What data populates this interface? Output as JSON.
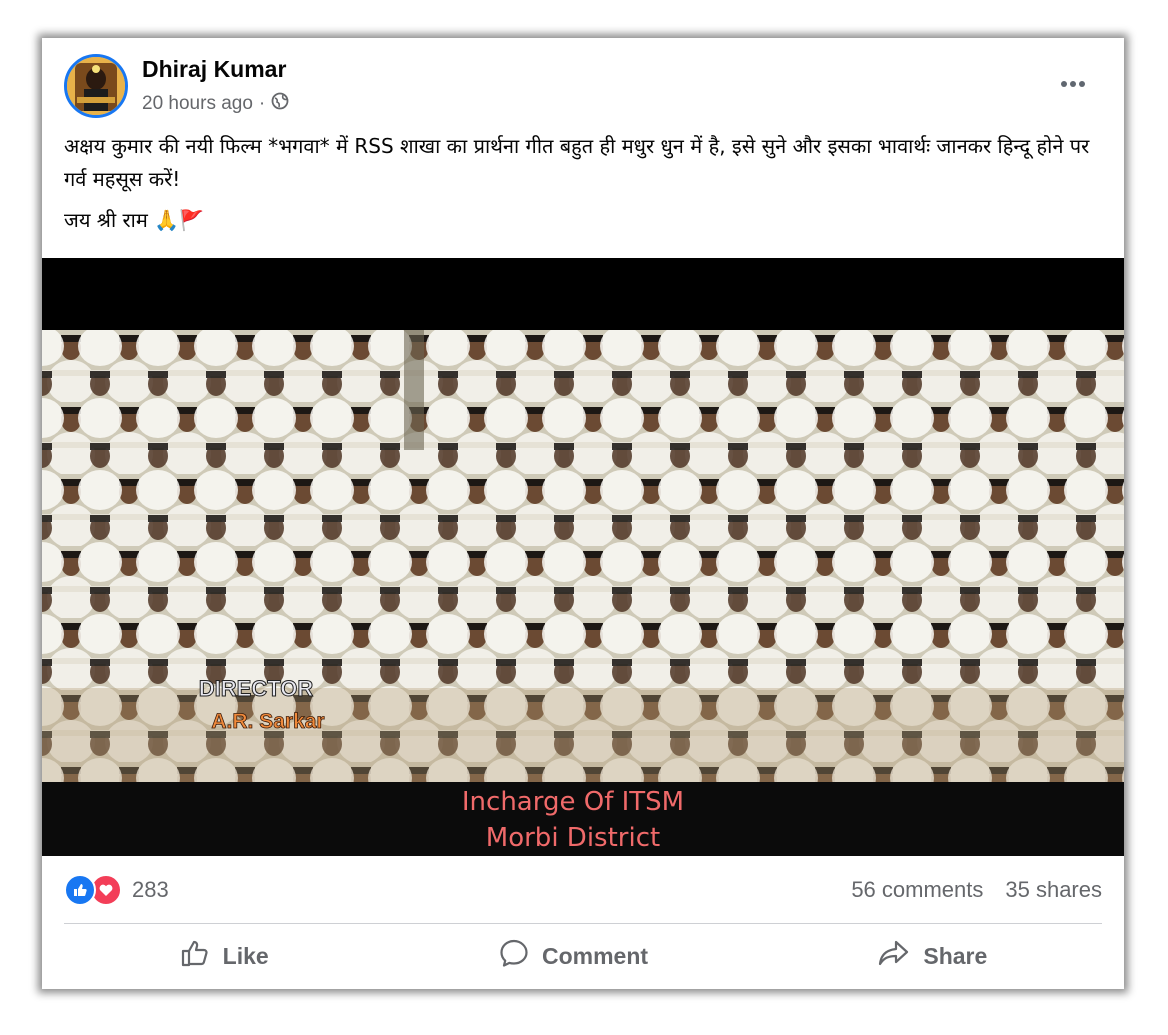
{
  "post": {
    "author": "Dhiraj Kumar",
    "time": "20 hours ago",
    "separator": "·",
    "privacy_icon": "globe-icon",
    "text_line1": "अक्षय कुमार की नयी फिल्म *भगवा* में RSS शाखा का प्रार्थना गीत बहुत ही मधुर धुन में है, इसे सुने और इसका भावार्थः जानकर हिन्दू होने पर गर्व महसूस करें!",
    "text_line2": "जय श्री राम 🙏🚩"
  },
  "video": {
    "credit_role": "DIRECTOR",
    "credit_name": "A.R. Sarkar",
    "caption_line1": "Incharge Of ITSM",
    "caption_line2": "Morbi District"
  },
  "stats": {
    "reaction_count": "283",
    "comments": "56 comments",
    "shares": "35 shares"
  },
  "actions": {
    "like": "Like",
    "comment": "Comment",
    "share": "Share"
  },
  "colors": {
    "like_blue": "#1877f2",
    "love_red": "#f33e58",
    "secondary_text": "#65676b"
  }
}
